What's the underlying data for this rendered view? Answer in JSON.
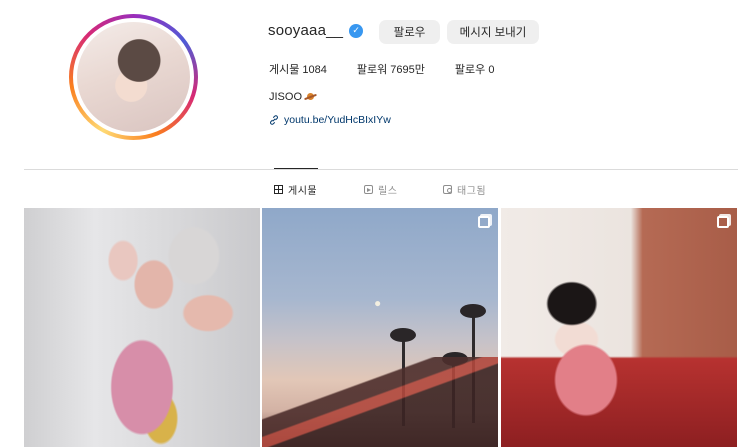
{
  "profile": {
    "username": "sooyaaa__",
    "verified_mark": "✓",
    "follow_label": "팔로우",
    "message_label": "메시지 보내기",
    "stats": {
      "posts": "게시물 1084",
      "followers": "팔로워 7695만",
      "following": "팔로우 0"
    },
    "bio_name": "JISOO",
    "link": "youtu.be/YudHcBIxIYw"
  },
  "tabs": [
    {
      "label": "게시물",
      "icon": "grid-icon",
      "active": true
    },
    {
      "label": "릴스",
      "icon": "reels-icon",
      "active": false
    },
    {
      "label": "태그됨",
      "icon": "tagged-icon",
      "active": false
    }
  ],
  "icons": {
    "verified": "verified-badge-icon",
    "bio_emoji": "planet-icon",
    "link": "link-icon",
    "multi_post": "multi-photo-icon"
  },
  "colors": {
    "verified_blue": "#3897f0",
    "link_blue": "#00376b",
    "button_bg": "#efefef",
    "muted_text": "#8e8e8e"
  }
}
